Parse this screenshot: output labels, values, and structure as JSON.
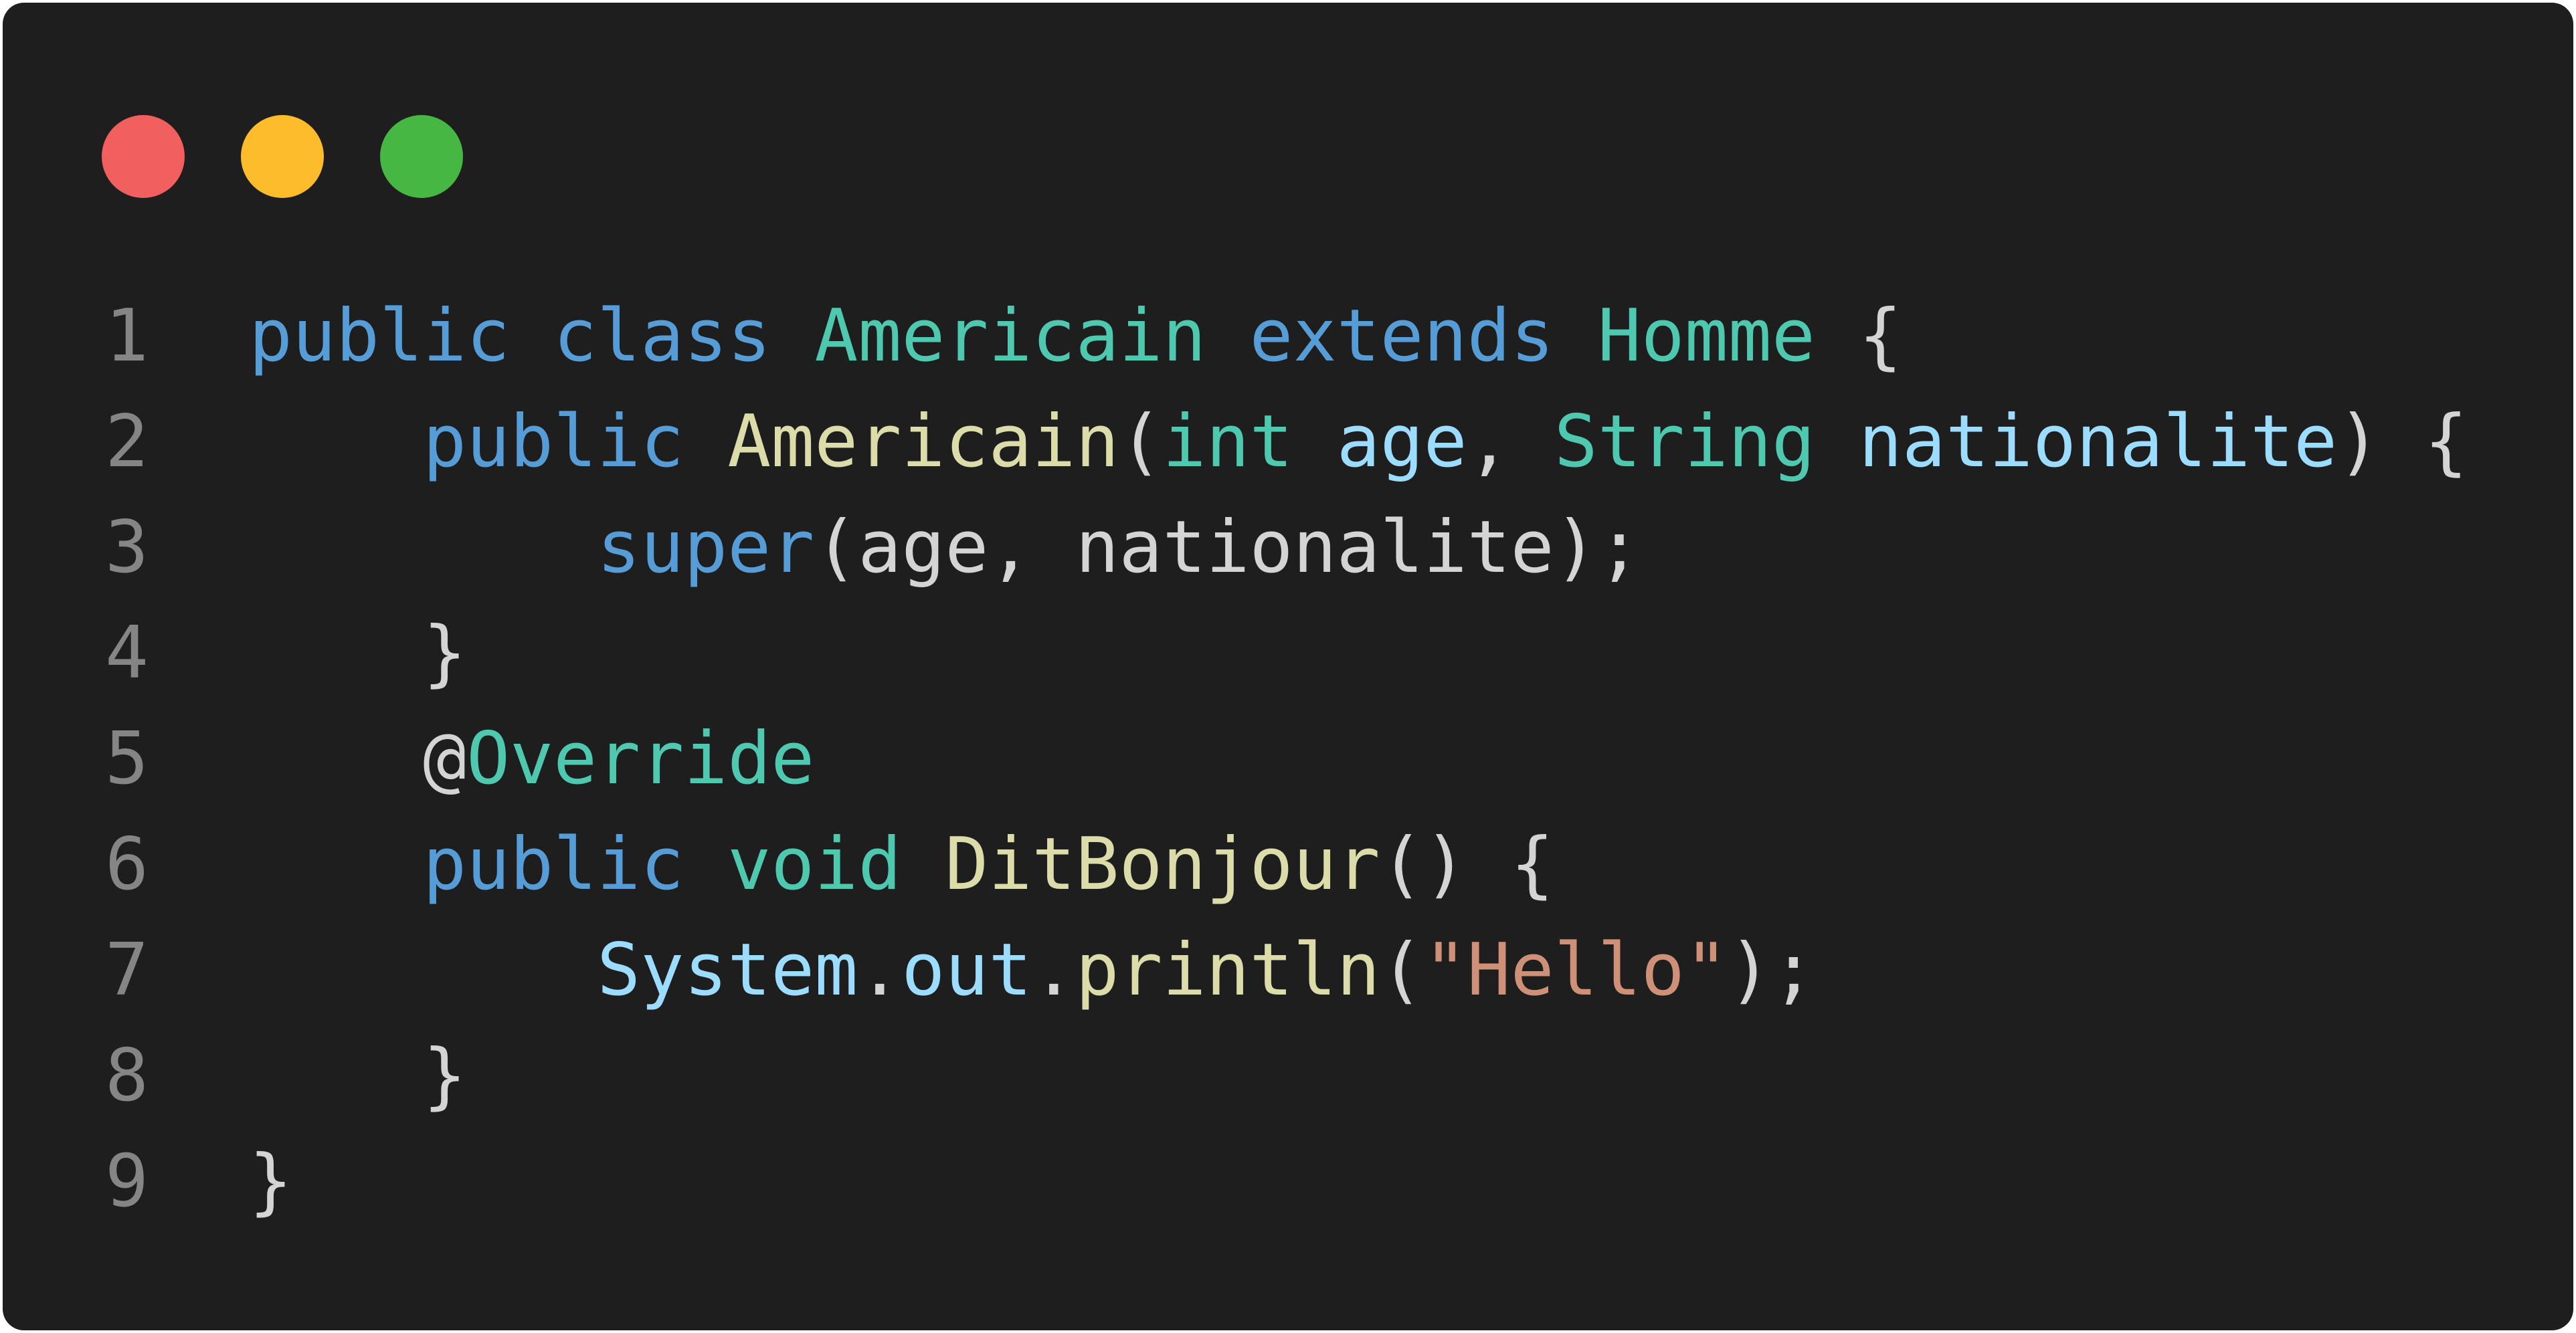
{
  "window": {
    "controls": [
      {
        "name": "close",
        "color": "#f15f5f"
      },
      {
        "name": "minimize",
        "color": "#fdbc2c"
      },
      {
        "name": "maximize",
        "color": "#46b742"
      }
    ]
  },
  "colors": {
    "keyword": "#569cd6",
    "type": "#4ec9b0",
    "function": "#dcdcaa",
    "variable": "#9cdcfe",
    "string": "#ce9178",
    "plain": "#d4d4d4",
    "line_number": "#858585",
    "background": "#1e1e1e"
  },
  "code": {
    "language": "java",
    "lines": [
      {
        "number": "1",
        "tokens": [
          {
            "t": "public",
            "c": "keyword"
          },
          {
            "t": " ",
            "c": "plain"
          },
          {
            "t": "class",
            "c": "keyword"
          },
          {
            "t": " ",
            "c": "plain"
          },
          {
            "t": "Americain",
            "c": "type"
          },
          {
            "t": " ",
            "c": "plain"
          },
          {
            "t": "extends",
            "c": "keyword"
          },
          {
            "t": " ",
            "c": "plain"
          },
          {
            "t": "Homme",
            "c": "type"
          },
          {
            "t": " {",
            "c": "plain"
          }
        ]
      },
      {
        "number": "2",
        "tokens": [
          {
            "t": "    ",
            "c": "plain"
          },
          {
            "t": "public",
            "c": "keyword"
          },
          {
            "t": " ",
            "c": "plain"
          },
          {
            "t": "Americain",
            "c": "function"
          },
          {
            "t": "(",
            "c": "plain"
          },
          {
            "t": "int",
            "c": "type"
          },
          {
            "t": " ",
            "c": "plain"
          },
          {
            "t": "age",
            "c": "variable"
          },
          {
            "t": ", ",
            "c": "plain"
          },
          {
            "t": "String",
            "c": "type"
          },
          {
            "t": " ",
            "c": "plain"
          },
          {
            "t": "nationalite",
            "c": "variable"
          },
          {
            "t": ") {",
            "c": "plain"
          }
        ]
      },
      {
        "number": "3",
        "tokens": [
          {
            "t": "        ",
            "c": "plain"
          },
          {
            "t": "super",
            "c": "keyword"
          },
          {
            "t": "(age, nationalite);",
            "c": "plain"
          }
        ]
      },
      {
        "number": "4",
        "tokens": [
          {
            "t": "    }",
            "c": "plain"
          }
        ]
      },
      {
        "number": "5",
        "tokens": [
          {
            "t": "    @",
            "c": "plain"
          },
          {
            "t": "Override",
            "c": "type"
          }
        ]
      },
      {
        "number": "6",
        "tokens": [
          {
            "t": "    ",
            "c": "plain"
          },
          {
            "t": "public",
            "c": "keyword"
          },
          {
            "t": " ",
            "c": "plain"
          },
          {
            "t": "void",
            "c": "type"
          },
          {
            "t": " ",
            "c": "plain"
          },
          {
            "t": "DitBonjour",
            "c": "function"
          },
          {
            "t": "() {",
            "c": "plain"
          }
        ]
      },
      {
        "number": "7",
        "tokens": [
          {
            "t": "        ",
            "c": "plain"
          },
          {
            "t": "System",
            "c": "variable"
          },
          {
            "t": ".",
            "c": "plain"
          },
          {
            "t": "out",
            "c": "variable"
          },
          {
            "t": ".",
            "c": "plain"
          },
          {
            "t": "println",
            "c": "function"
          },
          {
            "t": "(",
            "c": "plain"
          },
          {
            "t": "\"Hello\"",
            "c": "string"
          },
          {
            "t": ");",
            "c": "plain"
          }
        ]
      },
      {
        "number": "8",
        "tokens": [
          {
            "t": "    }",
            "c": "plain"
          }
        ]
      },
      {
        "number": "9",
        "tokens": [
          {
            "t": "}",
            "c": "plain"
          }
        ]
      }
    ]
  }
}
